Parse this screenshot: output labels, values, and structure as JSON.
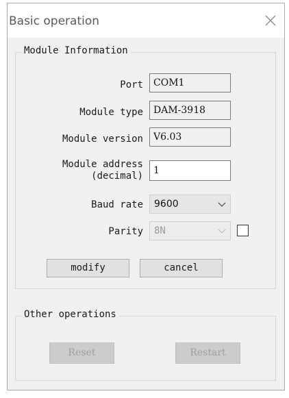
{
  "window": {
    "title": "Basic operation"
  },
  "module_info": {
    "group_title": "Module Information",
    "port_label": "Port",
    "port_value": "COM1",
    "type_label": "Module type",
    "type_value": "DAM-3918",
    "version_label": "Module version",
    "version_value": "V6.03",
    "address_label_line1": "Module address",
    "address_label_line2": "(decimal)",
    "address_value": "1",
    "baud_label": "Baud rate",
    "baud_value": "9600",
    "parity_label": "Parity",
    "parity_value": "8N",
    "parity_checkbox_checked": false,
    "modify_label": "modify",
    "cancel_label": "cancel"
  },
  "other_ops": {
    "group_title": "Other operations",
    "reset_label": "Reset",
    "restart_label": "Restart"
  },
  "icons": {
    "close": "close-icon",
    "dropdown": "chevron-down-icon"
  }
}
